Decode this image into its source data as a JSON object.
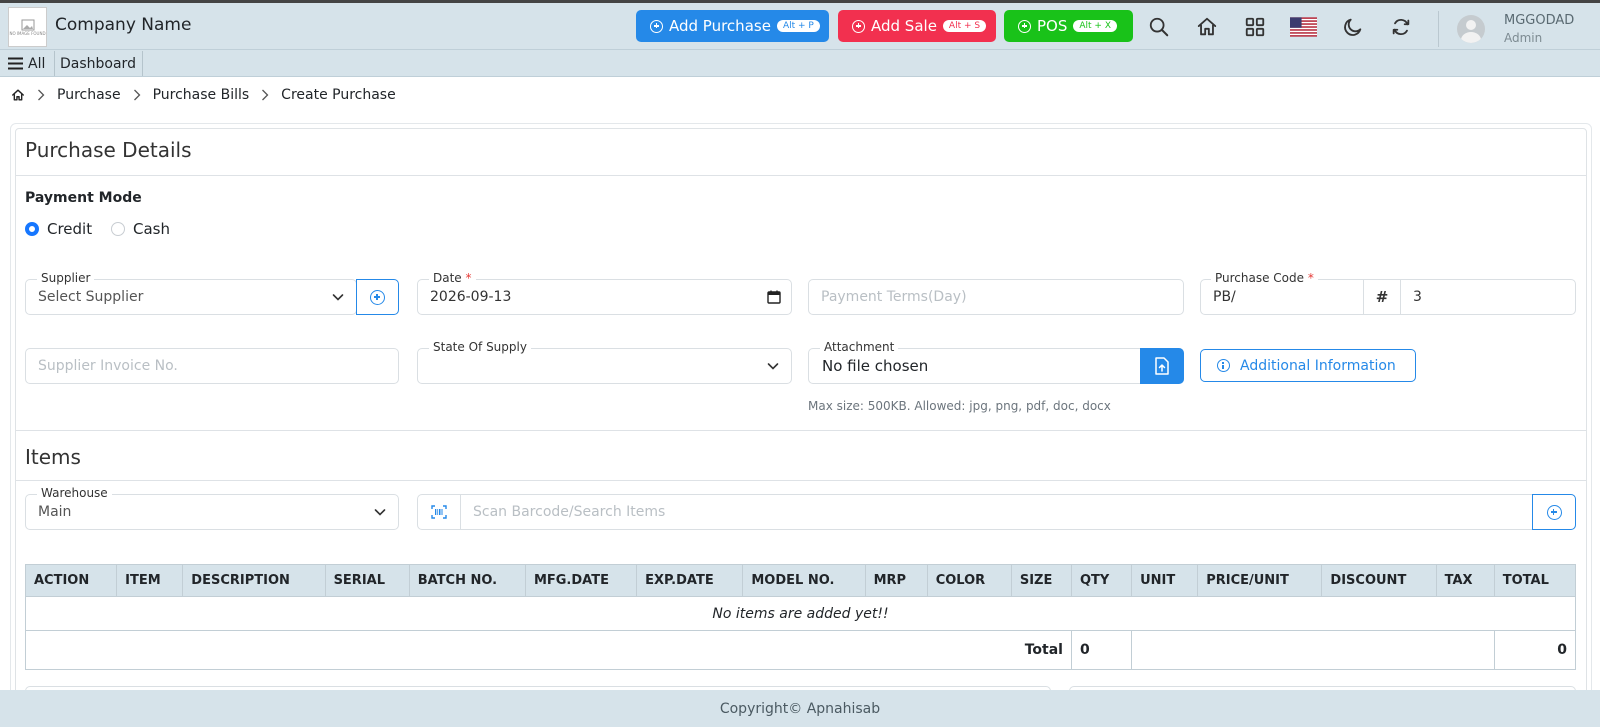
{
  "header": {
    "logo_text": "NO IMAGE FOUND",
    "company_name": "Company Name",
    "add_purchase": {
      "label": "Add Purchase",
      "shortcut": "Alt + P"
    },
    "add_sale": {
      "label": "Add Sale",
      "shortcut": "Alt + S"
    },
    "pos": {
      "label": "POS",
      "shortcut": "Alt + X"
    },
    "icons": [
      "search-icon",
      "home-icon",
      "grid-icon",
      "us-flag-icon",
      "moon-icon",
      "refresh-icon"
    ],
    "user": {
      "name": "MGGODAD",
      "role": "Admin"
    },
    "colors": {
      "purchase": "#2589e8",
      "sale": "#f2304f",
      "pos": "#19c219",
      "bar": "#d6e3ea"
    }
  },
  "subnav": {
    "all_label": "All",
    "dashboard_label": "Dashboard"
  },
  "breadcrumb": {
    "items": [
      "Purchase",
      "Purchase Bills",
      "Create Purchase"
    ]
  },
  "purchase_details": {
    "title": "Purchase Details",
    "payment_mode": {
      "label": "Payment Mode",
      "options": [
        "Credit",
        "Cash"
      ],
      "selected": "Credit"
    },
    "supplier": {
      "label": "Supplier",
      "value": "Select Supplier"
    },
    "date": {
      "label": "Date",
      "required": "*",
      "value": "2026-09-13"
    },
    "payment_terms": {
      "placeholder": "Payment Terms(Day)"
    },
    "purchase_code": {
      "label": "Purchase Code",
      "required": "*",
      "prefix": "PB/",
      "hash": "#",
      "number": "3"
    },
    "supplier_invoice": {
      "placeholder": "Supplier Invoice No."
    },
    "state_of_supply": {
      "label": "State Of Supply",
      "value": ""
    },
    "attachment": {
      "label": "Attachment",
      "value": "No file chosen",
      "help": "Max size: 500KB. Allowed: jpg, png, pdf, doc, docx"
    },
    "additional_info_label": "Additional Information"
  },
  "items": {
    "title": "Items",
    "warehouse": {
      "label": "Warehouse",
      "value": "Main"
    },
    "search_placeholder": "Scan Barcode/Search Items",
    "table": {
      "columns": [
        "ACTION",
        "ITEM",
        "DESCRIPTION",
        "SERIAL",
        "BATCH NO.",
        "MFG.DATE",
        "EXP.DATE",
        "MODEL NO.",
        "MRP",
        "COLOR",
        "SIZE",
        "QTY",
        "UNIT",
        "PRICE/UNIT",
        "DISCOUNT",
        "TAX",
        "TOTAL"
      ],
      "empty_message": "No items are added yet!!",
      "total_label": "Total",
      "total_qty": "0",
      "total_amount": "0"
    }
  },
  "footer": {
    "text": "Copyright© Apnahisab"
  }
}
